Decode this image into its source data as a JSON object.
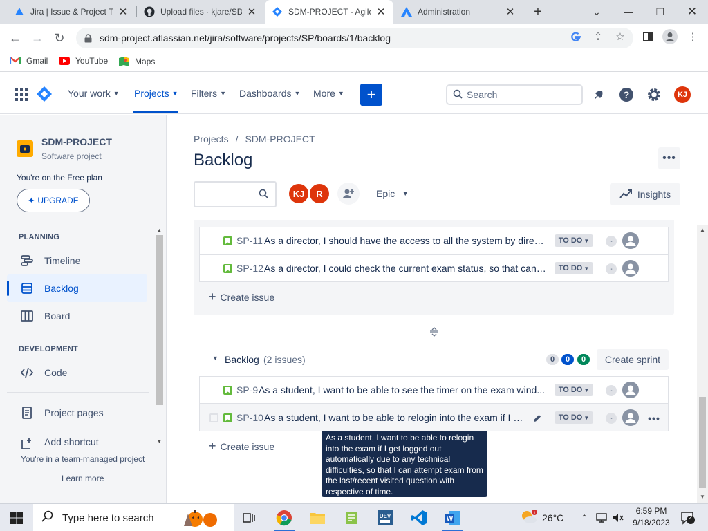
{
  "browser": {
    "tabs": [
      {
        "title": "Jira | Issue & Project Tr",
        "icon": "jira-icon",
        "active": false
      },
      {
        "title": "Upload files · kjare/SD",
        "icon": "github-icon",
        "active": false
      },
      {
        "title": "SDM-PROJECT - Agile",
        "icon": "jira-software-icon",
        "active": true
      },
      {
        "title": "Administration",
        "icon": "atlassian-icon",
        "active": false
      }
    ],
    "url": "sdm-project.atlassian.net/jira/software/projects/SP/boards/1/backlog",
    "bookmarks": [
      {
        "label": "Gmail",
        "icon": "gmail-icon"
      },
      {
        "label": "YouTube",
        "icon": "youtube-icon"
      },
      {
        "label": "Maps",
        "icon": "maps-icon"
      }
    ]
  },
  "topnav": {
    "items": [
      {
        "label": "Your work"
      },
      {
        "label": "Projects"
      },
      {
        "label": "Filters"
      },
      {
        "label": "Dashboards"
      },
      {
        "label": "More"
      }
    ],
    "search_placeholder": "Search",
    "user_initials": "KJ",
    "accent": "#0052cc"
  },
  "sidebar": {
    "project_name": "SDM-PROJECT",
    "project_type": "Software project",
    "free_plan": "You're on the Free plan",
    "upgrade": "UPGRADE",
    "planning_heading": "PLANNING",
    "planning_items": [
      {
        "label": "Timeline",
        "icon": "timeline-icon"
      },
      {
        "label": "Backlog",
        "icon": "backlog-icon"
      },
      {
        "label": "Board",
        "icon": "board-icon"
      }
    ],
    "development_heading": "DEVELOPMENT",
    "development_items": [
      {
        "label": "Code",
        "icon": "code-icon"
      }
    ],
    "extra_items": [
      {
        "label": "Project pages",
        "icon": "page-icon"
      },
      {
        "label": "Add shortcut",
        "icon": "add-shortcut-icon"
      }
    ],
    "footer_text": "You're in a team-managed project",
    "learn_more": "Learn more"
  },
  "main": {
    "breadcrumb": [
      "Projects",
      "SDM-PROJECT"
    ],
    "breadcrumb_sep": "/",
    "title": "Backlog",
    "avatars": [
      {
        "initials": "KJ",
        "color": "#de350b"
      },
      {
        "initials": "R",
        "color": "#de350b"
      }
    ],
    "epic_label": "Epic",
    "insights_label": "Insights",
    "sprint_issues": [
      {
        "key": "SP-11",
        "summary": "As a director, I should have the access to all the system by direct...",
        "status": "TO DO",
        "estimate": "-"
      },
      {
        "key": "SP-12",
        "summary": "As a director, I could check the current exam status, so that can ...",
        "status": "TO DO",
        "estimate": "-"
      }
    ],
    "create_issue": "Create issue",
    "backlog": {
      "title": "Backlog",
      "count": "(2 issues)",
      "counts": [
        {
          "value": "0",
          "bg": "#dfe1e6",
          "fg": "#42526e"
        },
        {
          "value": "0",
          "bg": "#0052cc",
          "fg": "#ffffff"
        },
        {
          "value": "0",
          "bg": "#00875a",
          "fg": "#ffffff"
        }
      ],
      "create_sprint": "Create sprint",
      "issues": [
        {
          "key": "SP-9",
          "summary": "As a student, I want to be able to see the timer on the exam wind...",
          "status": "TO DO",
          "estimate": "-"
        },
        {
          "key": "SP-10",
          "summary": "As a student, I want to be able to relogin into the exam if I l...",
          "status": "TO DO",
          "estimate": "-"
        }
      ]
    },
    "tooltip": "As a student, I want to be able to relogin into the exam if I get logged out automatically due to any technical difficulties, so that I can attempt exam from the last/recent visited question with respective of time."
  },
  "taskbar": {
    "search_placeholder": "Type here to search",
    "weather": "26°C",
    "time": "6:59 PM",
    "date": "9/18/2023",
    "notifications": "2"
  }
}
